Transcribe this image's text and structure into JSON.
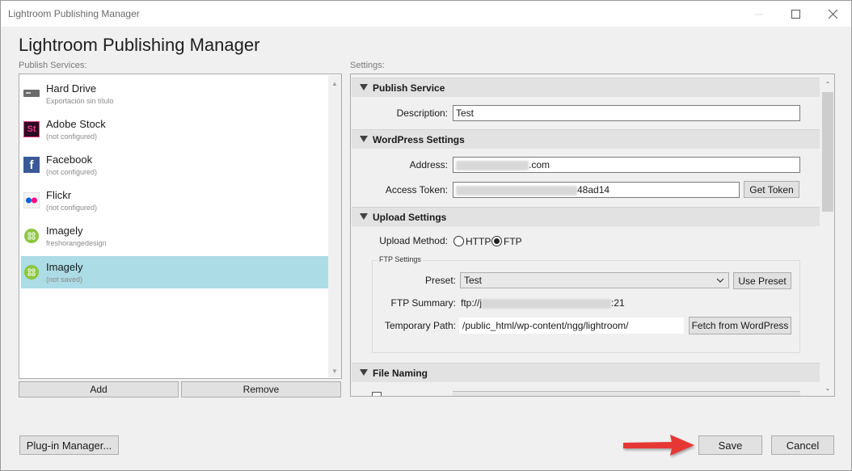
{
  "window": {
    "title": "Lightroom Publishing Manager",
    "heading": "Lightroom Publishing Manager"
  },
  "publish_services": {
    "label": "Publish Services:",
    "items": [
      {
        "name": "Hard Drive",
        "sub": "Exportación sin título",
        "icon": "hard-drive-icon"
      },
      {
        "name": "Adobe Stock",
        "sub": "(not configured)",
        "icon": "adobe-stock-icon",
        "icon_text": "St"
      },
      {
        "name": "Facebook",
        "sub": "(not configured)",
        "icon": "facebook-icon",
        "icon_text": "f"
      },
      {
        "name": "Flickr",
        "sub": "(not configured)",
        "icon": "flickr-icon"
      },
      {
        "name": "Imagely",
        "sub": "freshorangedesign",
        "icon": "imagely-icon"
      },
      {
        "name": "Imagely",
        "sub": "(not saved)",
        "icon": "imagely-icon",
        "selected": true
      }
    ],
    "add_label": "Add",
    "remove_label": "Remove"
  },
  "settings": {
    "label": "Settings:",
    "publish_service": {
      "header": "Publish Service",
      "description_label": "Description:",
      "description_value": "Test"
    },
    "wordpress": {
      "header": "WordPress Settings",
      "address_label": "Address:",
      "address_value": ".com",
      "token_label": "Access Token:",
      "token_value": "48ad14",
      "get_token_label": "Get Token"
    },
    "upload": {
      "header": "Upload Settings",
      "method_label": "Upload Method:",
      "http_label": "HTTP",
      "ftp_label": "FTP",
      "selected_method": "FTP",
      "ftp_group_label": "FTP Settings",
      "preset_label": "Preset:",
      "preset_value": "Test",
      "use_preset_label": "Use Preset",
      "summary_label": "FTP Summary:",
      "summary_prefix": "ftp://j",
      "summary_suffix": ":21",
      "temp_path_label": "Temporary Path:",
      "temp_path_value": "/public_html/wp-content/ngg/lightroom/",
      "fetch_label": "Fetch from WordPress"
    },
    "file_naming": {
      "header": "File Naming"
    }
  },
  "footer": {
    "plugin_manager_label": "Plug-in Manager...",
    "save_label": "Save",
    "cancel_label": "Cancel"
  },
  "colors": {
    "selected_row": "#acdce6",
    "section_header": "#e2e2e2",
    "annotation_arrow": "#e53935",
    "adobe_stock": "#2b0a23",
    "facebook": "#3b5998",
    "imagely": "#8cc63f"
  }
}
